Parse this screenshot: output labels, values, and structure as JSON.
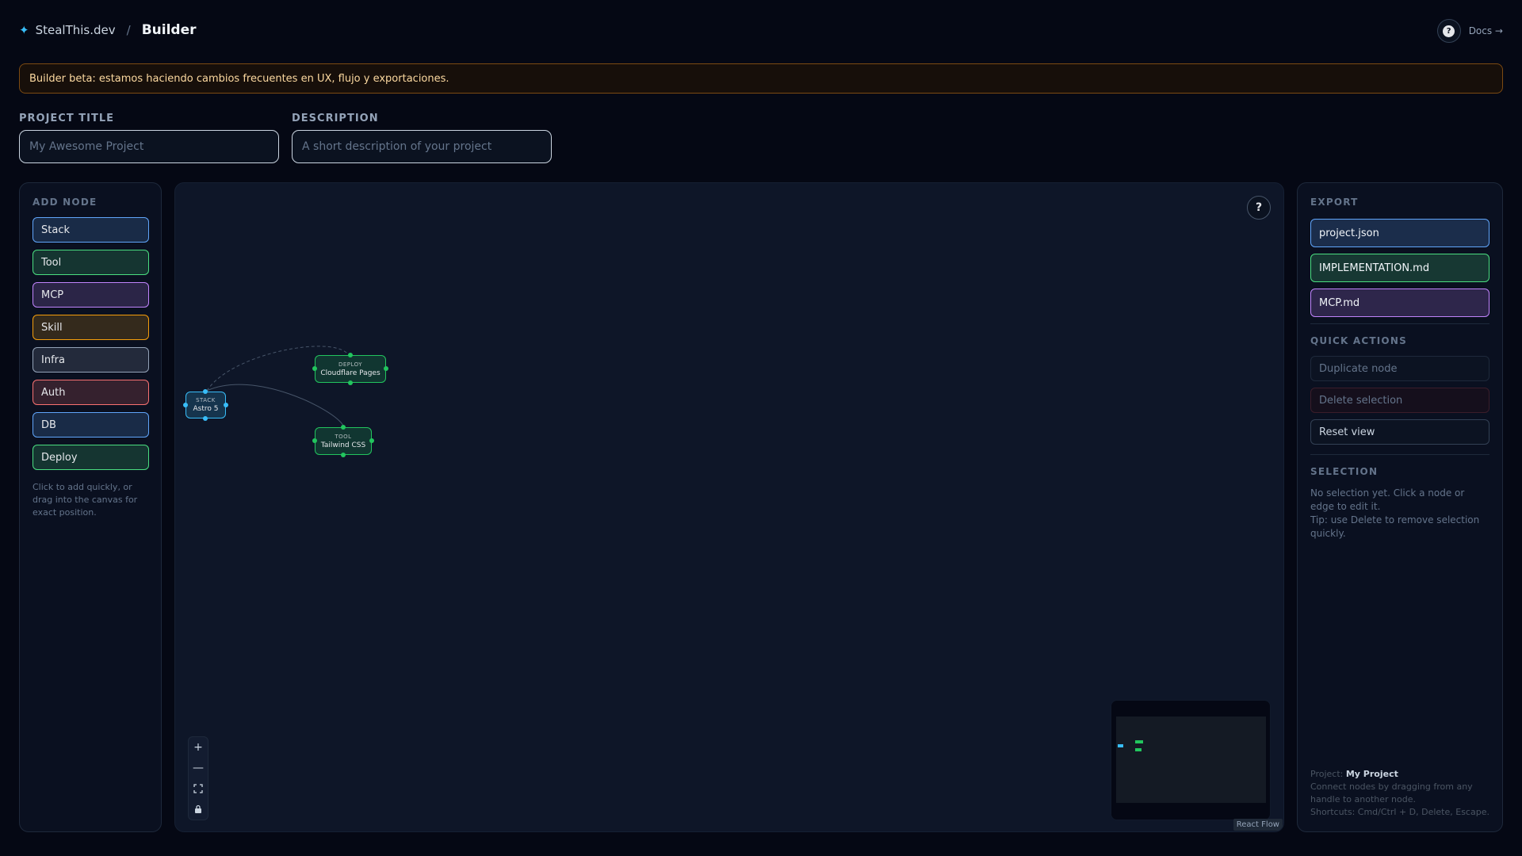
{
  "header": {
    "brand_icon": "sparkle-icon",
    "site_name": "StealThis.dev",
    "separator": "/",
    "page_title": "Builder",
    "docs_label": "Docs →"
  },
  "banner": {
    "text": "Builder beta: estamos haciendo cambios frecuentes en UX, flujo y exportaciones."
  },
  "form": {
    "title_label": "PROJECT TITLE",
    "title_placeholder": "My Awesome Project",
    "title_value": "",
    "description_label": "DESCRIPTION",
    "description_placeholder": "A short description of your project",
    "description_value": ""
  },
  "add_node": {
    "title": "ADD NODE",
    "items": [
      {
        "label": "Stack",
        "color": "#60a5fa"
      },
      {
        "label": "Tool",
        "color": "#4ade80"
      },
      {
        "label": "MCP",
        "color": "#c084fc"
      },
      {
        "label": "Skill",
        "color": "#f59e0b"
      },
      {
        "label": "Infra",
        "color": "#94a3b8"
      },
      {
        "label": "Auth",
        "color": "#f87171"
      },
      {
        "label": "DB",
        "color": "#60a5fa"
      },
      {
        "label": "Deploy",
        "color": "#4ade80"
      }
    ],
    "hint": "Click to add quickly, or drag into the canvas for exact position."
  },
  "canvas": {
    "help_label": "?",
    "nodes": [
      {
        "id": "stack",
        "kind": "STACK",
        "name": "Astro 5",
        "color": "#38bdf8"
      },
      {
        "id": "deploy",
        "kind": "DEPLOY",
        "name": "Cloudflare Pages",
        "color": "#22c55e"
      },
      {
        "id": "tool",
        "kind": "TOOL",
        "name": "Tailwind CSS",
        "color": "#22c55e"
      }
    ],
    "controls": {
      "zoom_in": "+",
      "zoom_out": "—",
      "fit_view": "fit-view-icon",
      "lock": "lock-icon"
    },
    "attribution": "React Flow"
  },
  "export": {
    "title": "EXPORT",
    "items": [
      {
        "label": "project.json",
        "color": "#60a5fa"
      },
      {
        "label": "IMPLEMENTATION.md",
        "color": "#4ade80"
      },
      {
        "label": "MCP.md",
        "color": "#c084fc"
      }
    ]
  },
  "quick_actions": {
    "title": "QUICK ACTIONS",
    "duplicate": "Duplicate node",
    "delete": "Delete selection",
    "reset": "Reset view"
  },
  "selection": {
    "title": "SELECTION",
    "empty": "No selection yet. Click a node or edge to edit it.",
    "tip": "Tip: use Delete to remove selection quickly."
  },
  "footer": {
    "project_label": "Project:",
    "project_name": "My Project",
    "help_text": "Connect nodes by dragging from any handle to another node.",
    "shortcuts": "Shortcuts: Cmd/Ctrl + D, Delete, Escape."
  }
}
